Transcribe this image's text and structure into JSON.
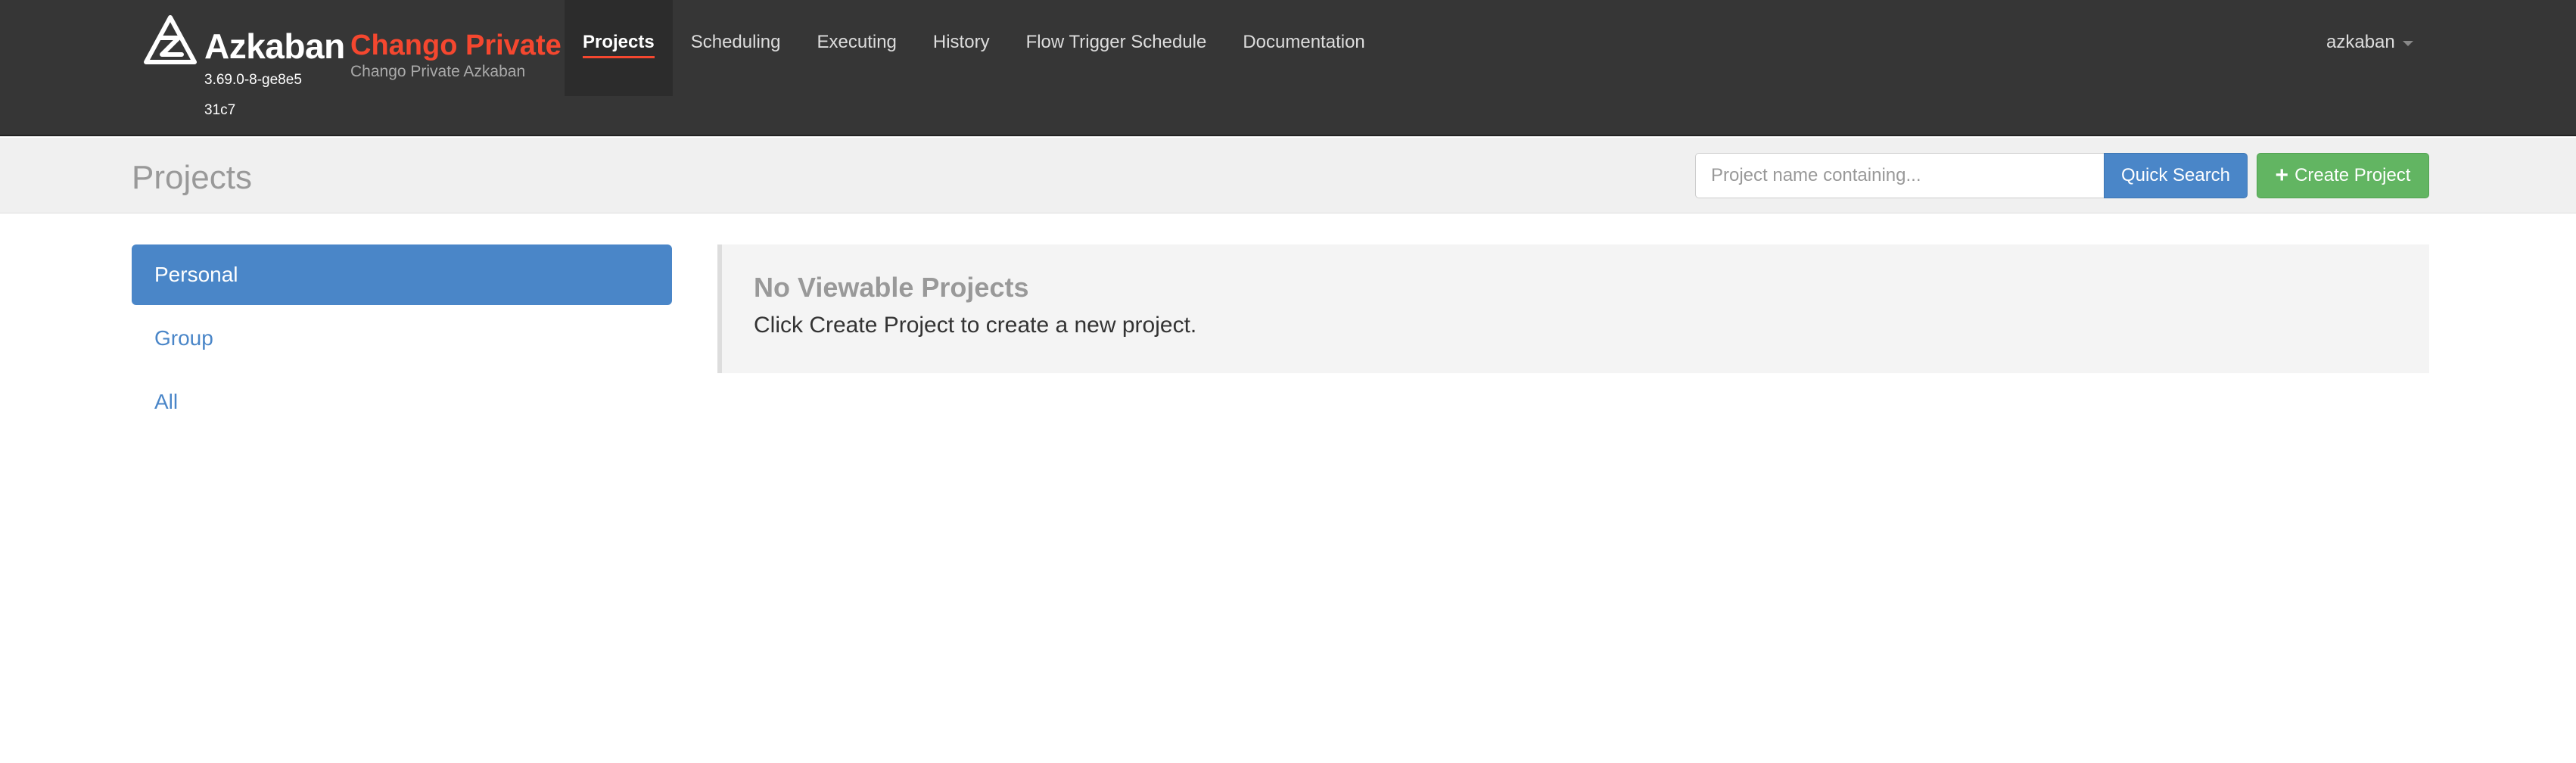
{
  "brand": {
    "name": "Azkaban",
    "env_name": "Chango Private",
    "env_subtitle": "Chango Private Azkaban",
    "version": "3.69.0-8-ge8e531c7"
  },
  "nav": {
    "items": [
      {
        "label": "Projects",
        "active": true
      },
      {
        "label": "Scheduling"
      },
      {
        "label": "Executing"
      },
      {
        "label": "History"
      },
      {
        "label": "Flow Trigger Schedule"
      },
      {
        "label": "Documentation"
      }
    ],
    "user": "azkaban"
  },
  "header": {
    "title": "Projects",
    "search_placeholder": "Project name containing...",
    "search_label": "Quick Search",
    "create_label": "Create Project"
  },
  "sidebar": {
    "items": [
      {
        "label": "Personal",
        "active": true
      },
      {
        "label": "Group"
      },
      {
        "label": "All"
      }
    ]
  },
  "main": {
    "empty_title": "No Viewable Projects",
    "empty_text": "Click Create Project to create a new project."
  },
  "colors": {
    "topbar": "#363636",
    "accent_red": "#f5472f",
    "primary_blue": "#4a86c8",
    "success_green": "#62b562"
  }
}
